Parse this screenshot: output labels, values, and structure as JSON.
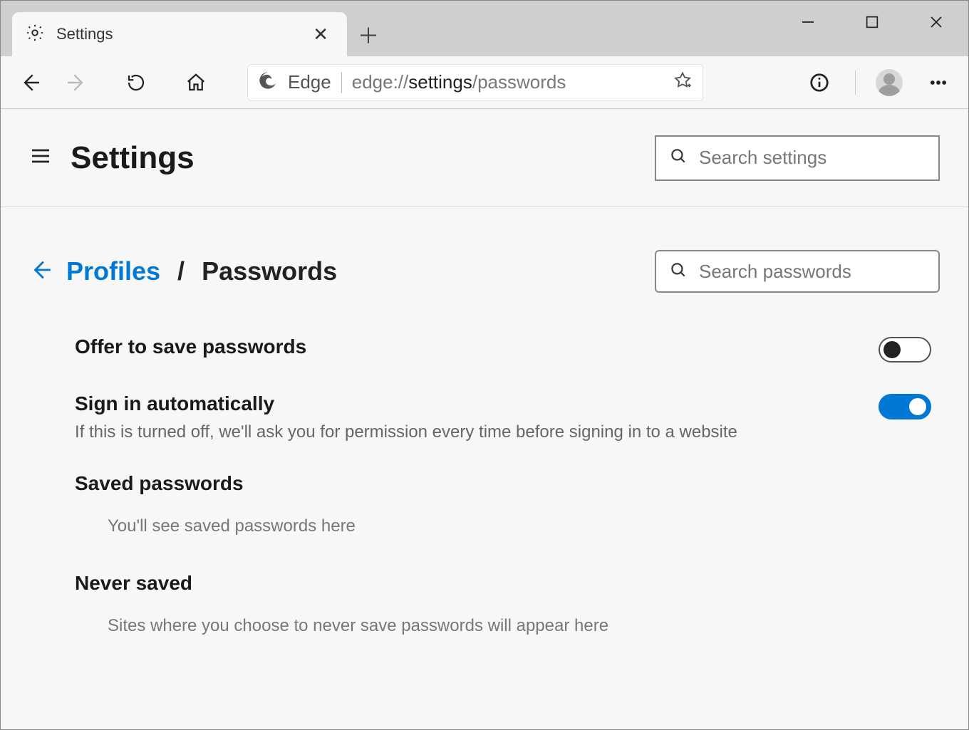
{
  "tab": {
    "title": "Settings"
  },
  "address": {
    "label": "Edge",
    "url_prefix": "edge://",
    "url_bold": "settings",
    "url_suffix": "/passwords"
  },
  "settings_header": {
    "title": "Settings",
    "search_placeholder": "Search settings"
  },
  "breadcrumb": {
    "parent": "Profiles",
    "separator": "/",
    "current": "Passwords",
    "search_placeholder": "Search passwords"
  },
  "rows": {
    "offer_save": {
      "title": "Offer to save passwords",
      "on": false
    },
    "auto_signin": {
      "title": "Sign in automatically",
      "desc": "If this is turned off, we'll ask you for permission every time before signing in to a website",
      "on": true
    },
    "saved": {
      "title": "Saved passwords",
      "sub": "You'll see saved passwords here"
    },
    "never": {
      "title": "Never saved",
      "sub": "Sites where you choose to never save passwords will appear here"
    }
  }
}
